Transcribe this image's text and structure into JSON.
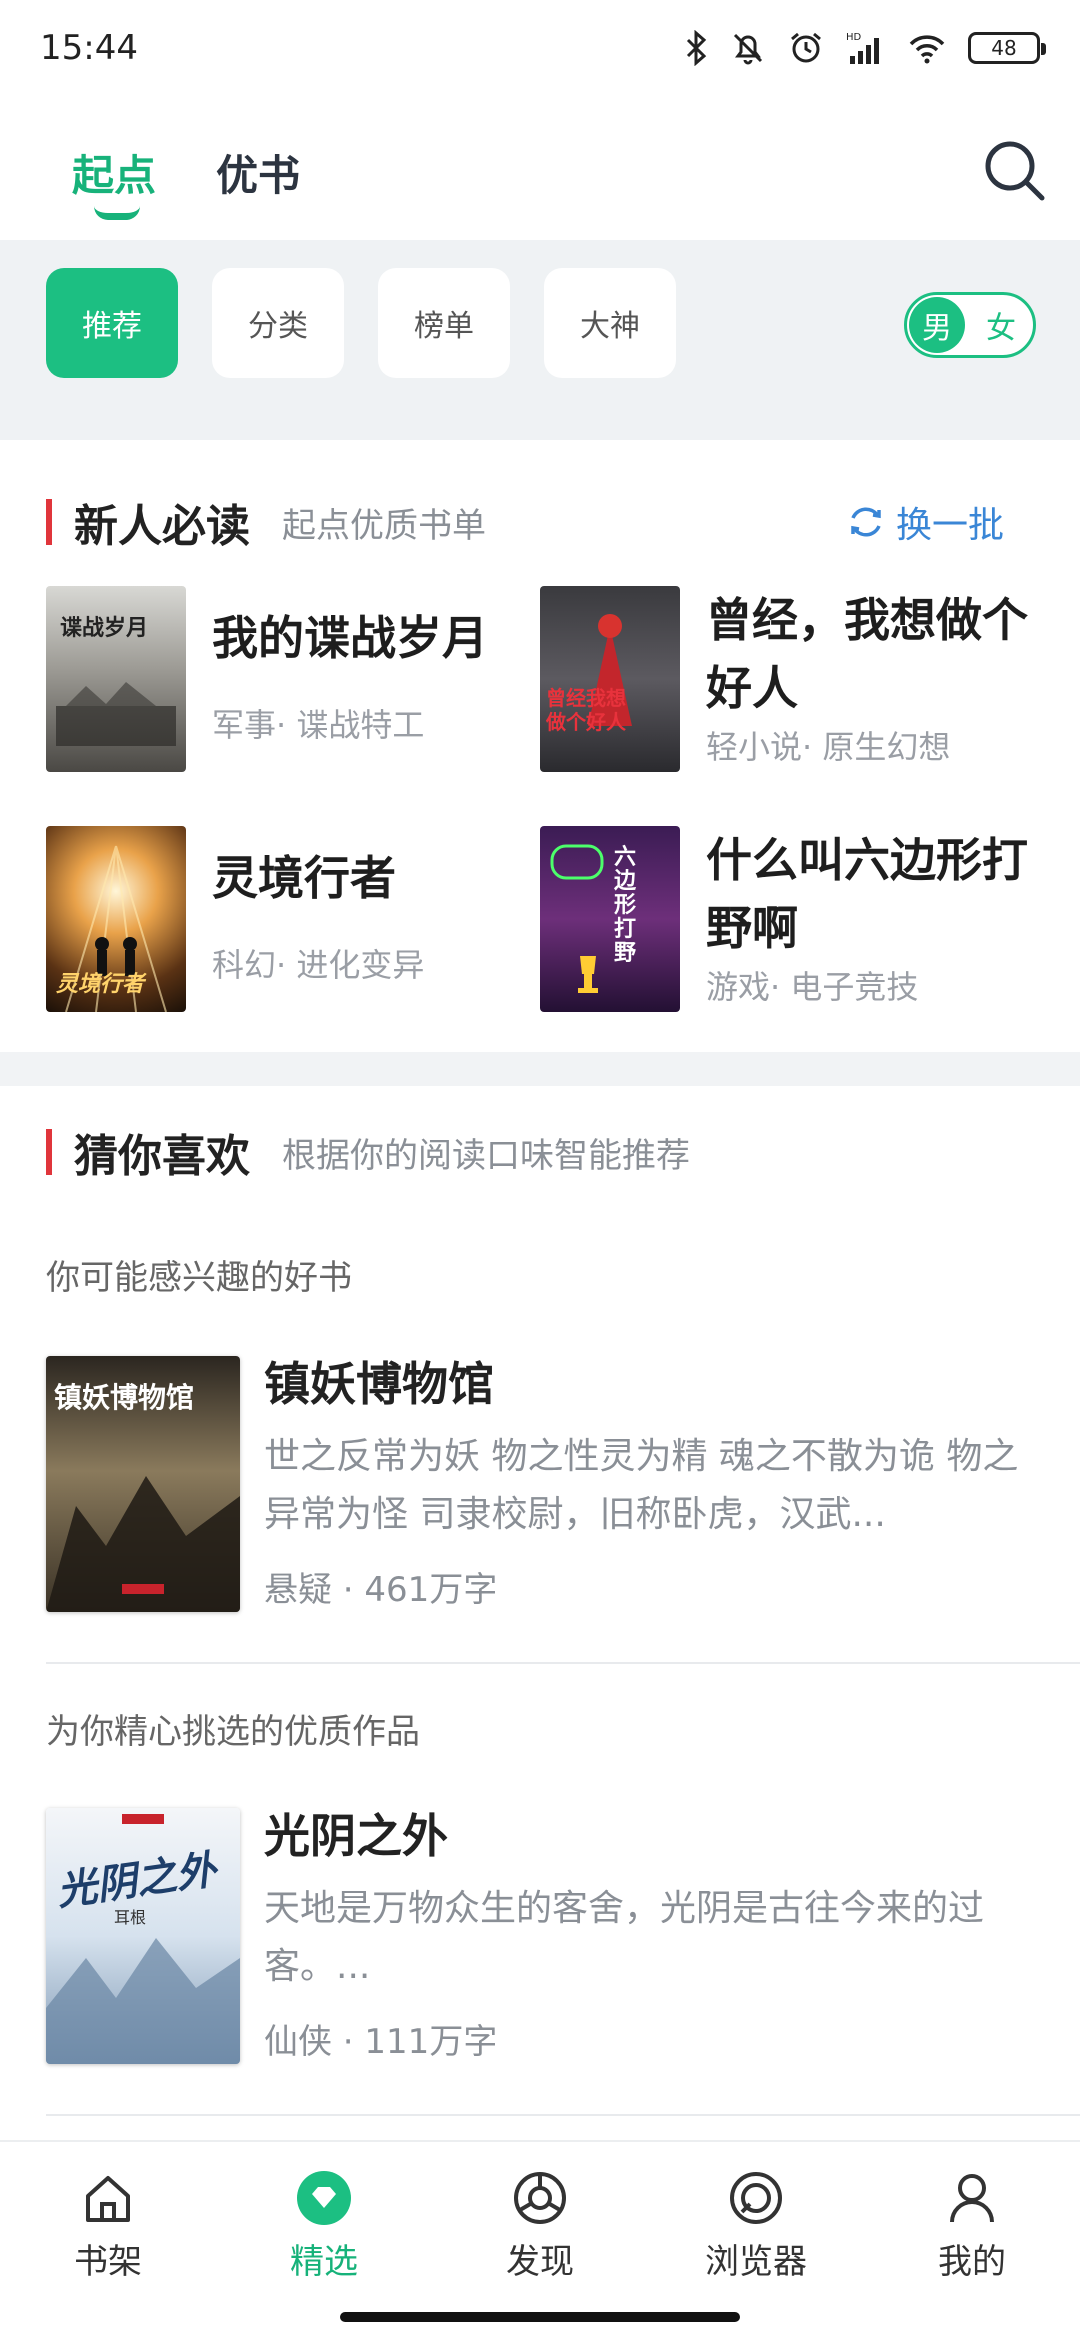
{
  "status": {
    "time": "15:44",
    "battery": "48"
  },
  "top_nav": {
    "tabs": [
      {
        "label": "起点"
      },
      {
        "label": "优书"
      }
    ]
  },
  "chips": [
    {
      "label": "推荐"
    },
    {
      "label": "分类"
    },
    {
      "label": "榜单"
    },
    {
      "label": "大神"
    }
  ],
  "gender": {
    "male": "男",
    "female": "女"
  },
  "section_new": {
    "title": "新人必读",
    "subtitle": "起点优质书单",
    "refresh": "换一批",
    "books": [
      {
        "title": "我的谍战岁月",
        "meta": "军事· 谍战特工",
        "cover_text": "谍战岁月"
      },
      {
        "title": "曾经，我想做个好人",
        "meta": "轻小说· 原生幻想",
        "cover_text": "曾经我想做个好人"
      },
      {
        "title": "灵境行者",
        "meta": "科幻· 进化变异",
        "cover_text": "灵境行者"
      },
      {
        "title": "什么叫六边形打野啊",
        "meta": "游戏· 电子竞技",
        "cover_text": "六边形打野"
      }
    ]
  },
  "section_guess": {
    "title": "猜你喜欢",
    "subtitle": "根据你的阅读口味智能推荐",
    "items": [
      {
        "hint": "你可能感兴趣的好书",
        "title": "镇妖博物馆",
        "desc": "世之反常为妖 物之性灵为精 魂之不散为诡 物之异常为怪 司隶校尉，旧称卧虎，汉武...",
        "meta": "悬疑 · 461万字",
        "cover_text": "镇妖博物馆"
      },
      {
        "hint": "为你精心挑选的优质作品",
        "title": "光阴之外",
        "desc": "天地是万物众生的客舍，光阴是古往今来的过客。...",
        "meta": "仙侠 · 111万字",
        "cover_text": "光阴之外",
        "cover_author": "耳根"
      }
    ]
  },
  "bottom_nav": [
    {
      "label": "书架",
      "icon": "house-icon"
    },
    {
      "label": "精选",
      "icon": "gem-icon"
    },
    {
      "label": "发现",
      "icon": "compass-icon"
    },
    {
      "label": "浏览器",
      "icon": "browser-icon"
    },
    {
      "label": "我的",
      "icon": "person-icon"
    }
  ],
  "colors": {
    "accent": "#1cbf82",
    "section_marker": "#e0353b",
    "link": "#3a86d6"
  }
}
